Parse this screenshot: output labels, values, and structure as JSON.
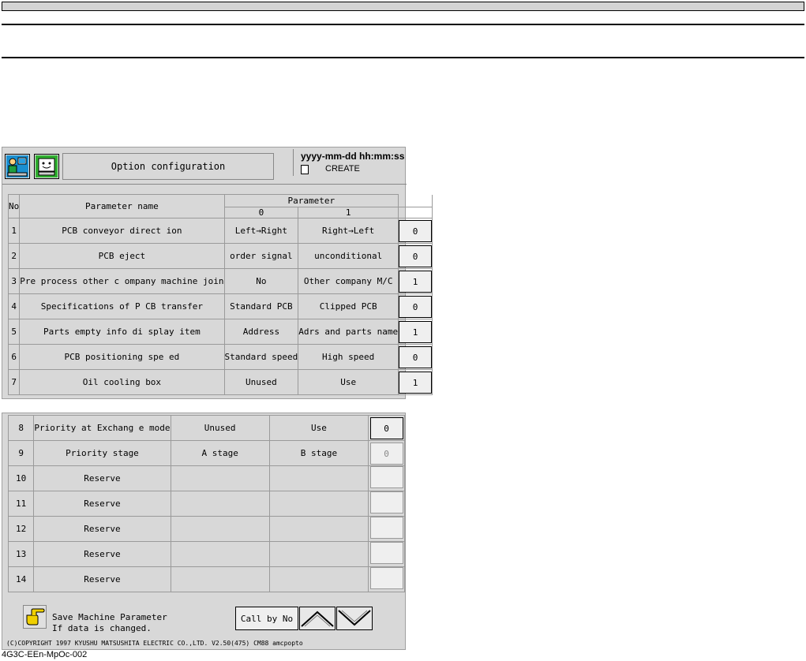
{
  "header": {
    "window_title": "Option configuration",
    "datetime": "yyyy-mm-dd  hh:mm:ss",
    "mode": "CREATE"
  },
  "icons": {
    "operator": "operator-icon",
    "machine": "machine-icon",
    "doc": "document-icon",
    "hand": "pointing-hand-icon",
    "up": "page-up-icon",
    "down": "page-down-icon"
  },
  "table": {
    "col_no": "No",
    "col_name": "Parameter name",
    "col_param": "Parameter",
    "col_0": "0",
    "col_1": "1",
    "rows_top": [
      {
        "no": "1",
        "name": "PCB conveyor direct ion",
        "opt0": "Left→Right",
        "opt1": "Right→Left",
        "value": "0"
      },
      {
        "no": "2",
        "name": "PCB eject",
        "opt0": "order signal",
        "opt1": "unconditional",
        "value": "0"
      },
      {
        "no": "3",
        "name": "Pre process other c ompany machine join",
        "opt0": "No",
        "opt1": "Other company M/C",
        "value": "1"
      },
      {
        "no": "4",
        "name": "Specifications of P CB transfer",
        "opt0": "Standard PCB",
        "opt1": "Clipped PCB",
        "value": "0"
      },
      {
        "no": "5",
        "name": "Parts empty info di splay item",
        "opt0": "Address",
        "opt1": "Adrs and parts name",
        "value": "1"
      },
      {
        "no": "6",
        "name": "PCB positioning spe ed",
        "opt0": "Standard speed",
        "opt1": "High speed",
        "value": "0"
      },
      {
        "no": "7",
        "name": "Oil cooling box",
        "opt0": "Unused",
        "opt1": "Use",
        "value": "1"
      }
    ],
    "rows_bottom": [
      {
        "no": "8",
        "name": "Priority at Exchang e mode",
        "opt0": "Unused",
        "opt1": "Use",
        "value": "0"
      },
      {
        "no": "9",
        "name": "Priority stage",
        "opt0": "A stage",
        "opt1": "B stage",
        "value": "0"
      },
      {
        "no": "10",
        "name": "Reserve",
        "opt0": "",
        "opt1": "",
        "value": ""
      },
      {
        "no": "11",
        "name": "Reserve",
        "opt0": "",
        "opt1": "",
        "value": ""
      },
      {
        "no": "12",
        "name": "Reserve",
        "opt0": "",
        "opt1": "",
        "value": ""
      },
      {
        "no": "13",
        "name": "Reserve",
        "opt0": "",
        "opt1": "",
        "value": ""
      },
      {
        "no": "14",
        "name": "Reserve",
        "opt0": "",
        "opt1": "",
        "value": ""
      }
    ]
  },
  "footer": {
    "save_line1": "Save Machine Parameter",
    "save_line2": "If data is changed.",
    "call_by_no": "Call by No",
    "copyright": "(C)COPYRIGHT 1997 KYUSHU MATSUSHITA ELECTRIC CO.,LTD. V2.50(475)   CM88      amcpopto"
  },
  "figure_id": "4G3C-EEn-MpOc-002"
}
